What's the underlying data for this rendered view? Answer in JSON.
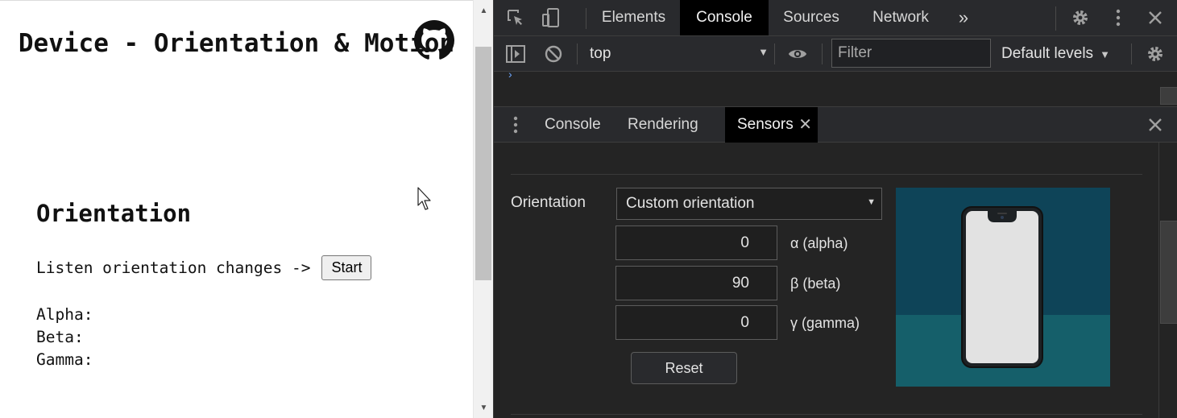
{
  "page": {
    "title": "Device - Orientation & Motion",
    "section_heading": "Orientation",
    "listen_label": "Listen orientation changes ->",
    "start_button": "Start",
    "readouts": {
      "alpha_label": "Alpha:",
      "beta_label": "Beta:",
      "gamma_label": "Gamma:"
    }
  },
  "devtools": {
    "main_tabs": [
      "Elements",
      "Console",
      "Sources",
      "Network"
    ],
    "selected_main_tab": "Console",
    "more_tabs_glyph": "»",
    "console_toolbar": {
      "context": "top",
      "filter_placeholder": "Filter",
      "levels": "Default levels"
    },
    "drawer_tabs": [
      "Console",
      "Rendering",
      "Sensors"
    ],
    "selected_drawer_tab": "Sensors",
    "sensors": {
      "orientation_label": "Orientation",
      "orientation_preset": "Custom orientation",
      "alpha_value": "0",
      "alpha_label": "α (alpha)",
      "beta_value": "90",
      "beta_label": "β (beta)",
      "gamma_value": "0",
      "gamma_label": "γ (gamma)",
      "reset_button": "Reset"
    }
  },
  "icons": {
    "toolbar": [
      "inspect-element-icon",
      "device-toolbar-icon",
      "settings-gear-icon",
      "more-vertical-icon",
      "close-icon"
    ],
    "console": [
      "sidebar-toggle-icon",
      "clear-console-icon",
      "live-expression-eye-icon",
      "console-settings-gear-icon"
    ],
    "drawer": [
      "drawer-menu-icon",
      "close-sensors-tab-icon",
      "close-drawer-icon"
    ],
    "page": [
      "github-icon",
      "mouse-cursor-icon"
    ]
  },
  "colors": {
    "devtools_bg": "#242424",
    "devtools_toolbar": "#292a2d",
    "selected_tab": "#000000",
    "phone_sky": "#0e4458",
    "phone_ground": "#155f6a"
  }
}
